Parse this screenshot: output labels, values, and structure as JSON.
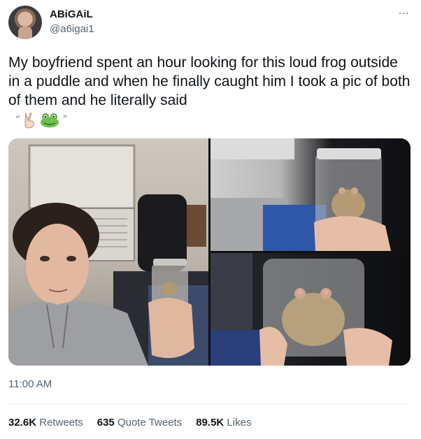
{
  "tweet": {
    "display_name": "ABiGAiL",
    "handle": "@a6igai1",
    "more_icon": "…",
    "text": "My boyfriend spent an hour looking for this loud frog outside in a puddle and when he finally caught him I took a pic of both of them and he literally said",
    "quote_open": "“",
    "quote_close": "”",
    "emojis": [
      "victory-hand-emoji",
      "frog-face-emoji"
    ],
    "timestamp": "11:00 AM",
    "retweets": "32.6K",
    "retweets_label": "Retweets",
    "quote_tweets": "635",
    "quote_tweets_label": "Quote Tweets",
    "likes": "89.5K",
    "likes_label": "Likes"
  },
  "media": {
    "photos": [
      "photo-man-holding-frog-jar",
      "photo-frog-jar-closeup-top",
      "photo-frog-jar-closeup-bottom"
    ]
  }
}
